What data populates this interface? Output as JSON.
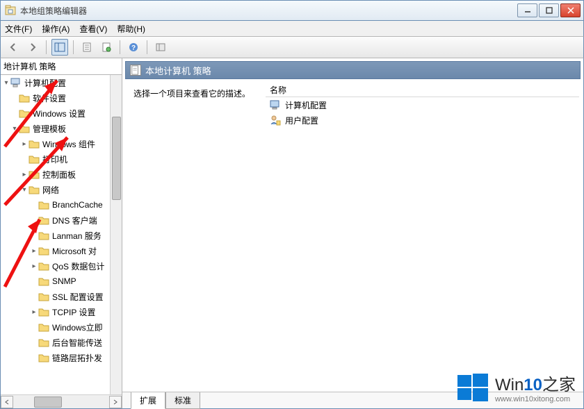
{
  "window": {
    "title": "本地组策略编辑器"
  },
  "menu": {
    "file": "文件(F)",
    "action": "操作(A)",
    "view": "查看(V)",
    "help": "帮助(H)"
  },
  "tree": {
    "header": "地计算机 策略",
    "root": "计算机配置",
    "items": [
      {
        "label": "软件设置",
        "indent": 1,
        "twisty": "none"
      },
      {
        "label": "Windows 设置",
        "indent": 1,
        "twisty": "none"
      },
      {
        "label": "管理模板",
        "indent": 1,
        "twisty": "open"
      },
      {
        "label": "Windows 组件",
        "indent": 2,
        "twisty": "closed"
      },
      {
        "label": "打印机",
        "indent": 2,
        "twisty": "none"
      },
      {
        "label": "控制面板",
        "indent": 2,
        "twisty": "closed"
      },
      {
        "label": "网络",
        "indent": 2,
        "twisty": "open"
      },
      {
        "label": "BranchCache",
        "indent": 3,
        "twisty": "none"
      },
      {
        "label": "DNS 客户端",
        "indent": 3,
        "twisty": "none"
      },
      {
        "label": "Lanman 服务",
        "indent": 3,
        "twisty": "none"
      },
      {
        "label": "Microsoft 对",
        "indent": 3,
        "twisty": "closed"
      },
      {
        "label": "QoS 数据包计",
        "indent": 3,
        "twisty": "closed"
      },
      {
        "label": "SNMP",
        "indent": 3,
        "twisty": "none"
      },
      {
        "label": "SSL 配置设置",
        "indent": 3,
        "twisty": "none"
      },
      {
        "label": "TCPIP 设置",
        "indent": 3,
        "twisty": "closed"
      },
      {
        "label": "Windows立即",
        "indent": 3,
        "twisty": "none"
      },
      {
        "label": "后台智能传送",
        "indent": 3,
        "twisty": "none"
      },
      {
        "label": "链路层拓扑发",
        "indent": 3,
        "twisty": "none"
      }
    ]
  },
  "panel": {
    "header": "本地计算机 策略",
    "desc": "选择一个项目来查看它的描述。",
    "col_name": "名称",
    "rows": [
      {
        "label": "计算机配置",
        "icon": "computer"
      },
      {
        "label": "用户配置",
        "icon": "user"
      }
    ]
  },
  "tabs": {
    "extend": "扩展",
    "standard": "标准"
  },
  "watermark": {
    "brand_a": "Win",
    "brand_b": "10",
    "brand_c": "之家",
    "url": "www.win10xitong.com"
  }
}
